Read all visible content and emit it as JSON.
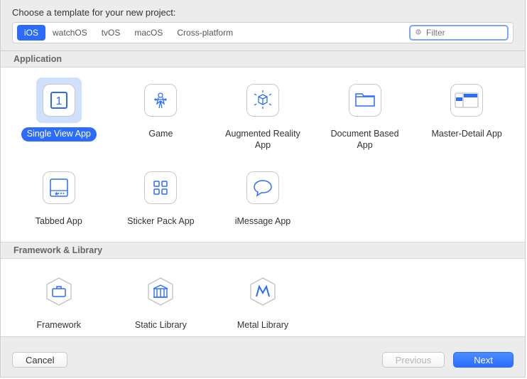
{
  "prompt": "Choose a template for your new project:",
  "tabs": [
    "iOS",
    "watchOS",
    "tvOS",
    "macOS",
    "Cross-platform"
  ],
  "selected_tab": 0,
  "filter_placeholder": "Filter",
  "sections": {
    "application": {
      "title": "Application",
      "items": [
        {
          "label": "Single View App",
          "icon": "single-view",
          "selected": true
        },
        {
          "label": "Game",
          "icon": "game",
          "selected": false
        },
        {
          "label": "Augmented Reality App",
          "icon": "ar",
          "selected": false
        },
        {
          "label": "Document Based App",
          "icon": "folder",
          "selected": false
        },
        {
          "label": "Master-Detail App",
          "icon": "master-detail",
          "selected": false
        },
        {
          "label": "Tabbed App",
          "icon": "tabbed",
          "selected": false
        },
        {
          "label": "Sticker Pack App",
          "icon": "sticker",
          "selected": false
        },
        {
          "label": "iMessage App",
          "icon": "imessage",
          "selected": false
        }
      ]
    },
    "framework": {
      "title": "Framework & Library",
      "items": [
        {
          "label": "Framework",
          "icon": "hex-briefcase",
          "selected": false
        },
        {
          "label": "Static Library",
          "icon": "hex-building",
          "selected": false
        },
        {
          "label": "Metal Library",
          "icon": "hex-metal",
          "selected": false
        }
      ]
    }
  },
  "buttons": {
    "cancel": "Cancel",
    "previous": "Previous",
    "next": "Next"
  },
  "colors": {
    "accent": "#2b6cff",
    "accent_light": "#cfe0ff"
  }
}
